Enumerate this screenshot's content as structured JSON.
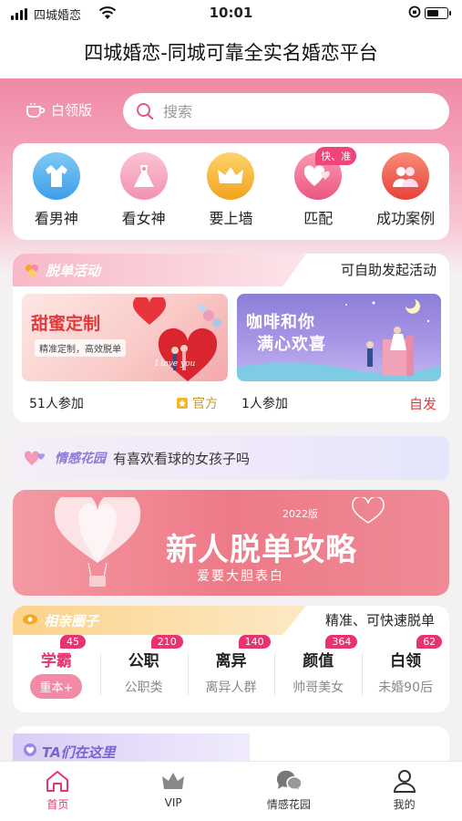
{
  "status_bar": {
    "carrier": "四城婚恋",
    "time": "10:01"
  },
  "title": "四城婚恋-同城可靠全实名婚恋平台",
  "header": {
    "edition_label": "白领版",
    "search_placeholder": "搜索"
  },
  "categories": [
    {
      "label": "看男神",
      "icon": "male-shirt-icon",
      "color": "#5bb6f0"
    },
    {
      "label": "看女神",
      "icon": "female-dress-icon",
      "color": "#f5a6be"
    },
    {
      "label": "要上墙",
      "icon": "crown-icon",
      "color": "#f7b733"
    },
    {
      "label": "匹配",
      "icon": "hearts-icon",
      "color": "#f06a8c",
      "tag": "快、准"
    },
    {
      "label": "成功案例",
      "icon": "couple-icon",
      "color": "#ef5c4c"
    }
  ],
  "activities": {
    "title": "脱单活动",
    "action": "可自助发起活动",
    "banners": [
      {
        "heading": "甜蜜定制",
        "subtitle": "精准定制，高效脱单",
        "script": "I love you",
        "participants": "51人参加",
        "source": "官方"
      },
      {
        "heading_line1": "咖啡和你",
        "heading_line2": "满心欢喜",
        "participants": "1人参加",
        "source": "自发"
      }
    ]
  },
  "garden": {
    "title": "情感花园",
    "topic": "有喜欢看球的女孩子吗"
  },
  "promo": {
    "year": "2022版",
    "title": "新人脱单攻略",
    "subtitle": "爱要大胆表白"
  },
  "circles": {
    "title": "相亲圈子",
    "action": "精准、可快速脱单",
    "items": [
      {
        "name": "学霸",
        "badge": "45",
        "sub": "重本+",
        "active": true
      },
      {
        "name": "公职",
        "badge": "210",
        "sub": "公职类"
      },
      {
        "name": "离异",
        "badge": "140",
        "sub": "离异人群"
      },
      {
        "name": "颜值",
        "badge": "364",
        "sub": "帅哥美女"
      },
      {
        "name": "白领",
        "badge": "62",
        "sub": "未婚90后"
      }
    ]
  },
  "ta_section": {
    "title": "TA们在这里"
  },
  "tabbar": [
    {
      "label": "首页",
      "icon": "home-icon",
      "active": true
    },
    {
      "label": "VIP",
      "icon": "crown-icon"
    },
    {
      "label": "情感花园",
      "icon": "chat-bubbles-icon"
    },
    {
      "label": "我的",
      "icon": "person-icon"
    }
  ],
  "colors": {
    "accent": "#e8346e",
    "hero": "#f08aa6"
  }
}
